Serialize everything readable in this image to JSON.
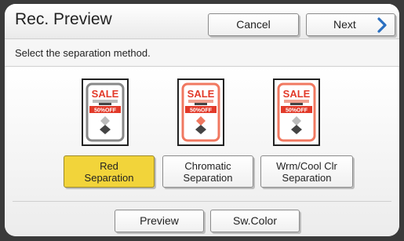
{
  "header": {
    "title": "Rec. Preview",
    "cancel_label": "Cancel",
    "next_label": "Next"
  },
  "instruction": "Select the separation method.",
  "thumbnail": {
    "sale_text": "SALE",
    "discount_text": "50%OFF"
  },
  "options": [
    {
      "line1": "Red",
      "line2": "Separation",
      "selected": true
    },
    {
      "line1": "Chromatic",
      "line2": "Separation",
      "selected": false
    },
    {
      "line1": "Wrm/Cool Clr",
      "line2": "Separation",
      "selected": false
    }
  ],
  "footer": {
    "preview_label": "Preview",
    "swcolor_label": "Sw.Color"
  },
  "colors": {
    "accent_selected": "#f2d43a",
    "sale_red": "#e23a2a",
    "chromatic_salmon": "#f07860",
    "next_chevron": "#2a6fc0"
  },
  "icons": [
    "chevron-right-icon"
  ]
}
